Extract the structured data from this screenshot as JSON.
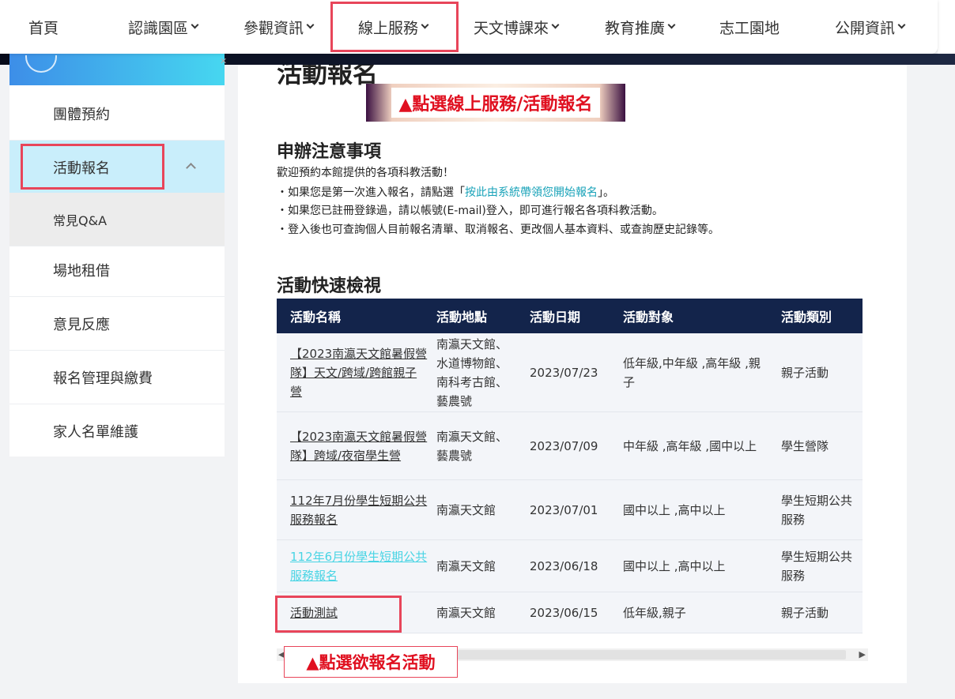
{
  "nav": {
    "items": [
      {
        "label": "首頁",
        "dropdown": false
      },
      {
        "label": "認識園區",
        "dropdown": true
      },
      {
        "label": "參觀資訊",
        "dropdown": true
      },
      {
        "label": "線上服務",
        "dropdown": true
      },
      {
        "label": "天文博課來",
        "dropdown": true
      },
      {
        "label": "教育推廣",
        "dropdown": true
      },
      {
        "label": "志工園地",
        "dropdown": false
      },
      {
        "label": "公開資訊",
        "dropdown": true
      }
    ]
  },
  "sidebar": {
    "items": [
      {
        "label": "團體預約"
      },
      {
        "label": "活動報名",
        "active": true
      },
      {
        "label": "常見Q&A",
        "sub": true
      },
      {
        "label": "場地租借"
      },
      {
        "label": "意見反應"
      },
      {
        "label": "報名管理與繳費"
      },
      {
        "label": "家人名單維護"
      }
    ]
  },
  "main": {
    "title": "活動報名",
    "callout_top": "▲點選線上服務/活動報名",
    "notice_title": "申辦注意事項",
    "notice": {
      "line1": "歡迎預約本館提供的各項科教活動！",
      "line2_pre": "・如果您是第一次進入報名，請點選「",
      "line2_link": "按此由系統帶領您開始報名",
      "line2_post": "」。",
      "line3": "・如果您已註冊登錄過，請以帳號(E-mail)登入，即可進行報名各項科教活動。",
      "line4": "・登入後也可查詢個人目前報名清單、取消報名、更改個人基本資料、或查詢歷史記錄等。"
    },
    "quick_title": "活動快速檢視",
    "callout_bottom": "▲點選欲報名活動"
  },
  "table": {
    "headers": [
      "活動名稱",
      "活動地點",
      "活動日期",
      "活動對象",
      "活動類別"
    ],
    "rows": [
      {
        "name": "【2023南瀛天文館暑假營隊】天文/跨域/跨館親子營",
        "place": "南瀛天文館、水道博物館、南科考古館、藝農號",
        "date": "2023/07/23",
        "target": "低年級,中年級 ,高年級 ,親子",
        "category": "親子活動",
        "visited": false
      },
      {
        "name": "【2023南瀛天文館暑假營隊】跨域/夜宿學生營",
        "place": "南瀛天文館、藝農號",
        "date": "2023/07/09",
        "target": "中年級 ,高年級 ,國中以上",
        "category": "學生營隊",
        "visited": false
      },
      {
        "name": "112年7月份學生短期公共服務報名",
        "place": "南瀛天文館",
        "date": "2023/07/01",
        "target": "國中以上 ,高中以上",
        "category": "學生短期公共服務",
        "visited": false
      },
      {
        "name": "112年6月份學生短期公共服務報名",
        "place": "南瀛天文館",
        "date": "2023/06/18",
        "target": "國中以上 ,高中以上",
        "category": "學生短期公共服務",
        "visited": true
      },
      {
        "name": "活動測試",
        "place": "南瀛天文館",
        "date": "2023/06/15",
        "target": "低年級,親子",
        "category": "親子活動",
        "visited": false
      }
    ]
  },
  "colors": {
    "accent_cyan": "#46d7f0",
    "table_header": "#13244b",
    "annotation_red": "#e8455a",
    "link_teal": "#17a2b8"
  }
}
